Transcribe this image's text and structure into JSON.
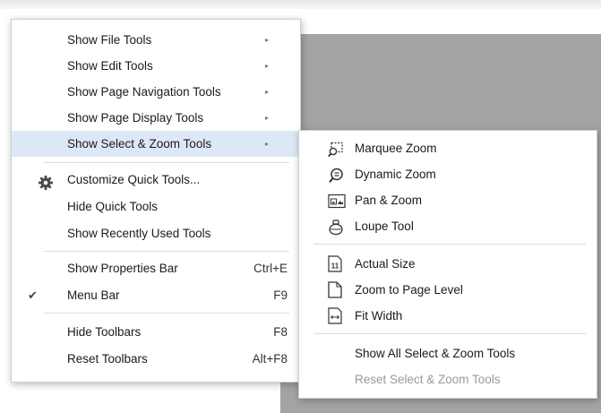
{
  "main_menu": {
    "items": [
      {
        "label": "Show File Tools",
        "arrow": "▸"
      },
      {
        "label": "Show Edit Tools",
        "arrow": "▸"
      },
      {
        "label": "Show Page Navigation Tools",
        "arrow": "▸"
      },
      {
        "label": "Show Page Display Tools",
        "arrow": "▸"
      },
      {
        "label": "Show Select & Zoom Tools",
        "arrow": "▸"
      },
      {
        "label": "Customize Quick Tools...",
        "icon": "gear-icon"
      },
      {
        "label": "Hide Quick Tools"
      },
      {
        "label": "Show Recently Used Tools"
      },
      {
        "label": "Show Properties Bar",
        "shortcut": "Ctrl+E"
      },
      {
        "label": "Menu Bar",
        "shortcut": "F9",
        "check": "✔"
      },
      {
        "label": "Hide Toolbars",
        "shortcut": "F8"
      },
      {
        "label": "Reset Toolbars",
        "shortcut": "Alt+F8"
      }
    ]
  },
  "sub_menu": {
    "items": [
      {
        "label": "Marquee Zoom",
        "icon": "marquee-zoom-icon"
      },
      {
        "label": "Dynamic Zoom",
        "icon": "dynamic-zoom-icon"
      },
      {
        "label": "Pan & Zoom",
        "icon": "pan-zoom-icon"
      },
      {
        "label": "Loupe Tool",
        "icon": "loupe-tool-icon"
      },
      {
        "label": "Actual Size",
        "icon": "actual-size-icon",
        "icon_text": "11"
      },
      {
        "label": "Zoom to Page Level",
        "icon": "page-icon"
      },
      {
        "label": "Fit Width",
        "icon": "fit-width-icon"
      },
      {
        "label": "Show All Select & Zoom Tools"
      },
      {
        "label": "Reset Select & Zoom Tools",
        "disabled": true
      }
    ]
  },
  "colors": {
    "highlight": "#dce8f6",
    "document_background": "#a4a4a4",
    "disabled_text": "#9a9a9a"
  }
}
